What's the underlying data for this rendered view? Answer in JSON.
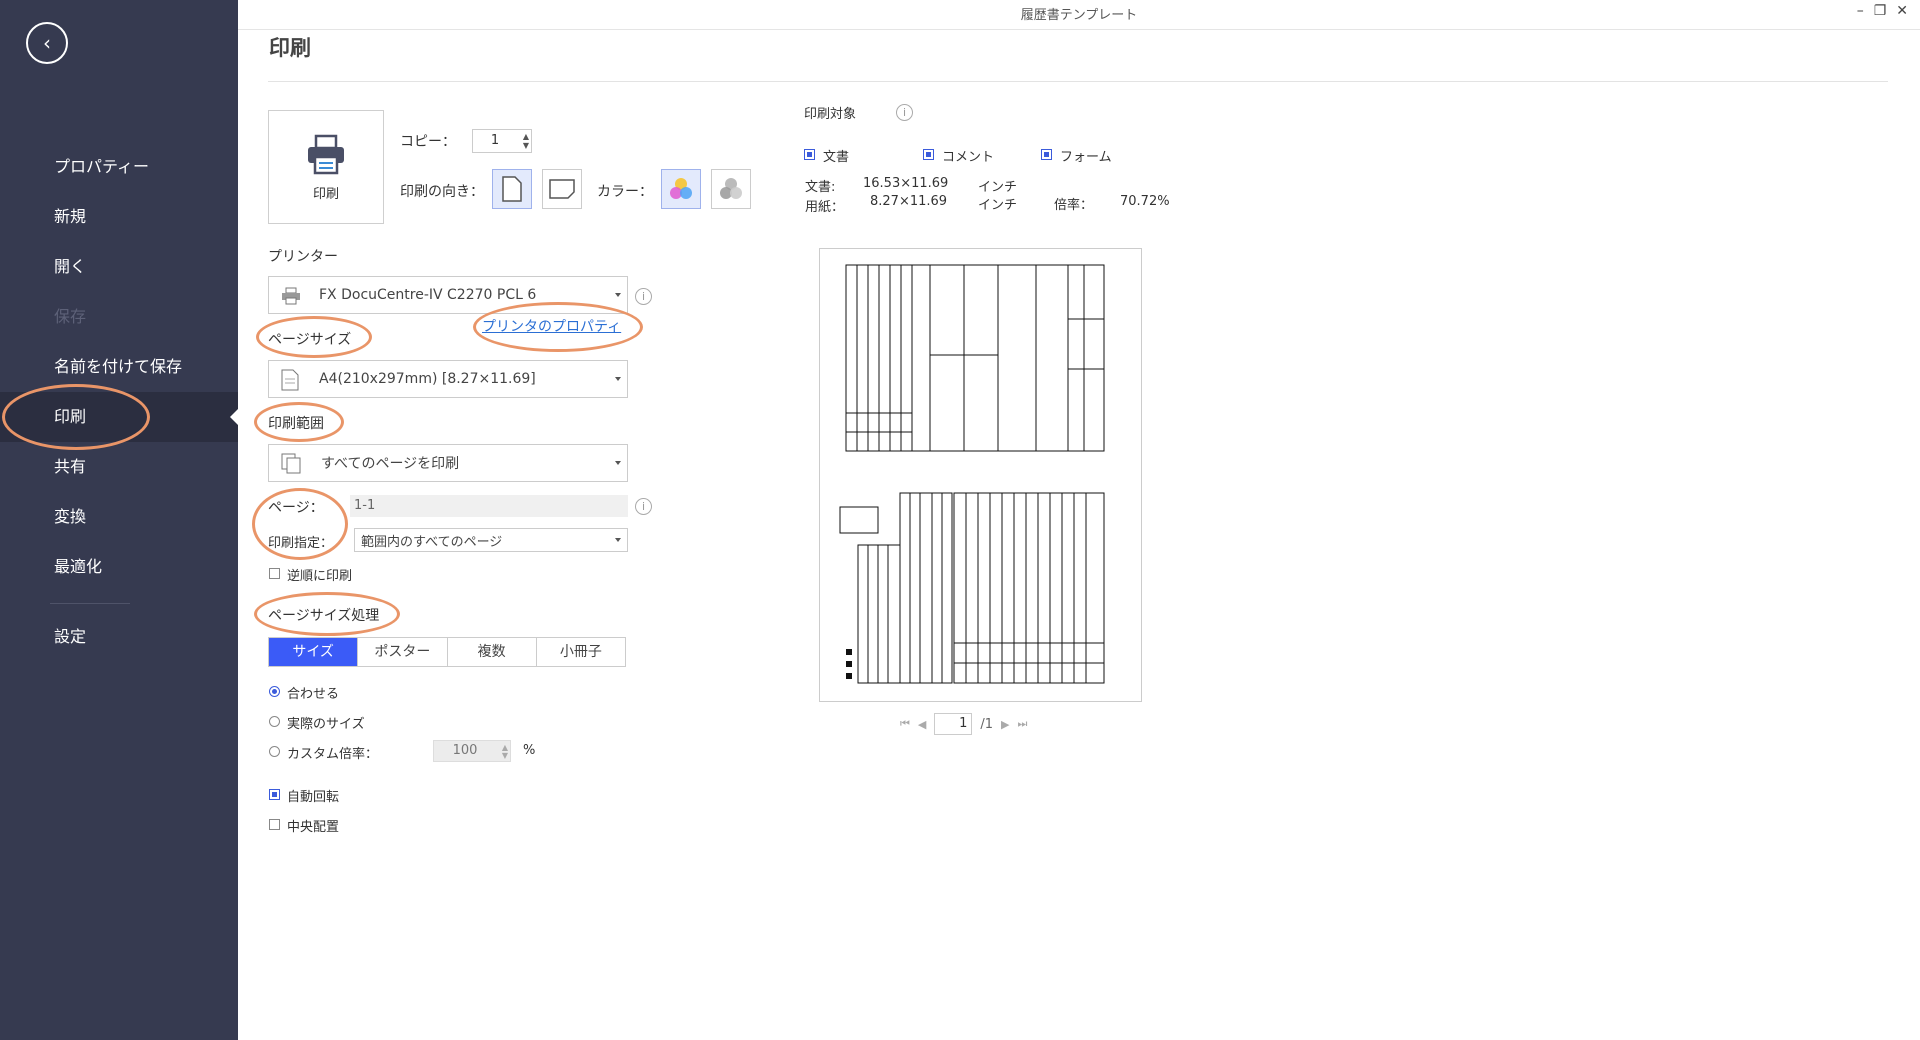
{
  "window": {
    "title": "履歴書テンプレート"
  },
  "sidebar": {
    "items": [
      {
        "label": "プロパティー"
      },
      {
        "label": "新規"
      },
      {
        "label": "開く"
      },
      {
        "label": "保存"
      },
      {
        "label": "名前を付けて保存"
      },
      {
        "label": "印刷"
      },
      {
        "label": "共有"
      },
      {
        "label": "変換"
      },
      {
        "label": "最適化"
      },
      {
        "label": "設定"
      }
    ],
    "active_index": 5
  },
  "page": {
    "title": "印刷"
  },
  "print_button": {
    "label": "印刷"
  },
  "copies": {
    "label": "コピー：",
    "value": "1"
  },
  "orientation": {
    "label": "印刷の向き："
  },
  "color": {
    "label": "カラー："
  },
  "printer": {
    "label": "プリンター",
    "selected": "FX DocuCentre-IV C2270 PCL 6",
    "properties_link": "プリンタのプロパティ"
  },
  "page_size": {
    "label": "ページサイズ",
    "selected": "A4(210x297mm) [8.27×11.69]"
  },
  "print_range": {
    "label": "印刷範囲",
    "selected": "すべてのページを印刷",
    "pages_label": "ページ：",
    "pages_value": "1-1",
    "subset_label": "印刷指定：",
    "subset_value": "範囲内のすべてのページ",
    "reverse_label": "逆順に印刷"
  },
  "page_handling": {
    "label": "ページサイズ処理",
    "tabs": [
      "サイズ",
      "ポスター",
      "複数",
      "小冊子"
    ],
    "active_tab": 0,
    "options": [
      "合わせる",
      "実際のサイズ",
      "カスタム倍率："
    ],
    "selected_option": 0,
    "custom_scale": "100",
    "custom_scale_unit": "%",
    "auto_rotate": "自動回転",
    "center": "中央配置"
  },
  "print_target": {
    "label": "印刷対象",
    "items": [
      "文書",
      "コメント",
      "フォーム"
    ],
    "doc_label": "文書:",
    "doc_size": "16.53×11.69",
    "doc_unit": "インチ",
    "paper_label": "用紙：",
    "paper_size": "8.27×11.69",
    "paper_unit": "インチ",
    "scale_label": "倍率：",
    "scale_value": "70.72%"
  },
  "pager": {
    "current": "1",
    "total": "/1"
  },
  "colors": {
    "sidebar": "#363a50",
    "accent": "#3b5bf7",
    "annotation": "#e99568",
    "link": "#2b6fd4"
  }
}
